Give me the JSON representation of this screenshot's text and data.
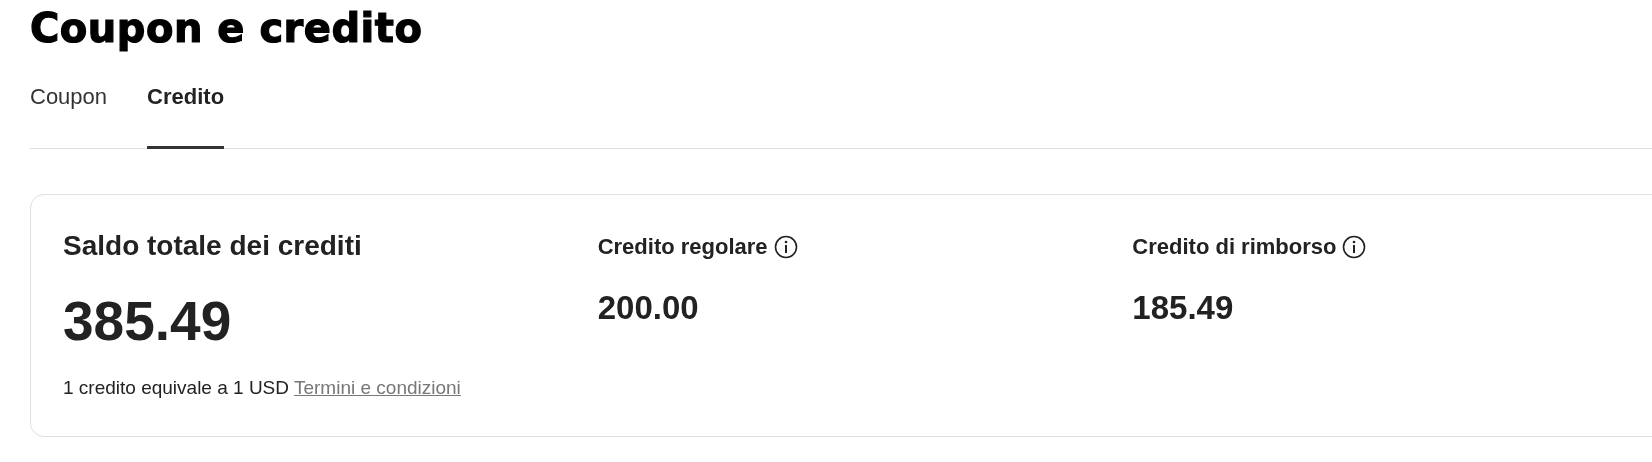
{
  "title": "Coupon e credito",
  "tabs": [
    {
      "label": "Coupon",
      "selected": false
    },
    {
      "label": "Credito",
      "selected": true
    }
  ],
  "credit_card": {
    "total": {
      "label": "Saldo totale dei crediti",
      "amount": "385.49",
      "note": "1 credito equivale a 1 USD",
      "link": "Termini e condizioni"
    },
    "breakdown": [
      {
        "label": "Credito regolare",
        "amount": "200.00"
      },
      {
        "label": "Credito di rimborso",
        "amount": "185.49"
      }
    ]
  }
}
